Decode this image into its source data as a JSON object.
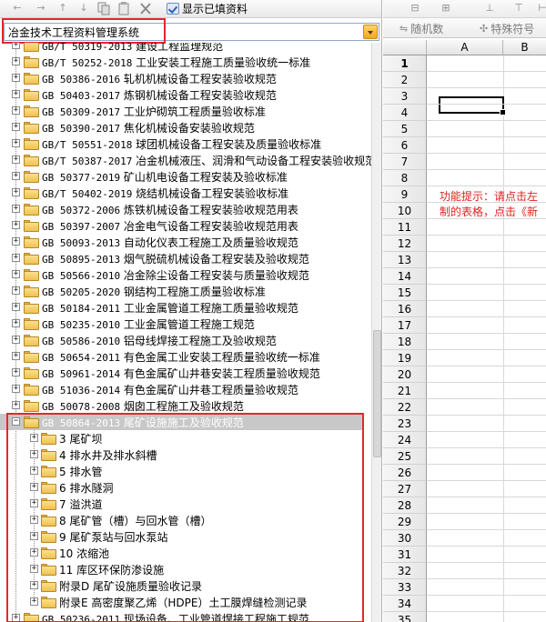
{
  "left_toolbar": {
    "show_filled_label": "显示已填资料",
    "icons": [
      "arrow-left-icon",
      "arrow-right-icon",
      "arrow-up-icon",
      "arrow-down-icon",
      "copy-icon",
      "paste-icon",
      "delete-icon"
    ]
  },
  "system_select": {
    "value": "冶金技术工程资料管理系统"
  },
  "tree": {
    "items": [
      {
        "code": "GB/T 50319-2013",
        "title": "建设工程监理规范"
      },
      {
        "code": "GB/T 50252-2018",
        "title": "工业安装工程施工质量验收统一标准"
      },
      {
        "code": "GB 50386-2016",
        "title": "轧机机械设备工程安装验收规范"
      },
      {
        "code": "GB 50403-2017",
        "title": "炼钢机械设备工程安装验收规范"
      },
      {
        "code": "GB 50309-2017",
        "title": "工业炉砌筑工程质量验收标准"
      },
      {
        "code": "GB 50390-2017",
        "title": "焦化机械设备安装验收规范"
      },
      {
        "code": "GB/T 50551-2018",
        "title": "球团机械设备工程安装及质量验收标准"
      },
      {
        "code": "GB/T 50387-2017",
        "title": "冶金机械液压、润滑和气动设备工程安装验收规范"
      },
      {
        "code": "GB 50377-2019",
        "title": "矿山机电设备工程安装及验收标准"
      },
      {
        "code": "GB/T 50402-2019",
        "title": "烧结机械设备工程安装验收标准"
      },
      {
        "code": "GB 50372-2006",
        "title": "炼铁机械设备工程安装验收规范用表"
      },
      {
        "code": "GB 50397-2007",
        "title": "冶金电气设备工程安装验收规范用表"
      },
      {
        "code": "GB 50093-2013",
        "title": "自动化仪表工程施工及质量验收规范"
      },
      {
        "code": "GB 50895-2013",
        "title": "烟气脱硫机械设备工程安装及验收规范"
      },
      {
        "code": "GB 50566-2010",
        "title": "冶金除尘设备工程安装与质量验收规范"
      },
      {
        "code": "GB 50205-2020",
        "title": "钢结构工程施工质量验收标准"
      },
      {
        "code": "GB 50184-2011",
        "title": "工业金属管道工程施工质量验收规范"
      },
      {
        "code": "GB 50235-2010",
        "title": "工业金属管道工程施工规范"
      },
      {
        "code": "GB 50586-2010",
        "title": "铝母线焊接工程施工及验收规范"
      },
      {
        "code": "GB 50654-2011",
        "title": "有色金属工业安装工程质量验收统一标准"
      },
      {
        "code": "GB 50961-2014",
        "title": "有色金属矿山井巷安装工程质量验收规范"
      },
      {
        "code": "GB 51036-2014",
        "title": "有色金属矿山井巷工程质量验收规范"
      },
      {
        "code": "GB 50078-2008",
        "title": "烟囱工程施工及验收规范"
      }
    ],
    "expanded": {
      "code": "GB 50864-2013",
      "title": "尾矿设施施工及验收规范"
    },
    "children": [
      "3 尾矿坝",
      "4 排水井及排水斜槽",
      "5 排水管",
      "6 排水隧洞",
      "7 溢洪道",
      "8 尾矿管（槽）与回水管（槽）",
      "9 尾矿泵站与回水泵站",
      "10 浓缩池",
      "11 库区环保防渗设施",
      "附录D 尾矿设施质量验收记录",
      "附录E 高密度聚乙烯（HDPE）土工膜焊缝检测记录"
    ],
    "last_partial": {
      "code": "GB 50236-2011",
      "title": "现场设备、工业管道焊接工程施工规范"
    }
  },
  "right_toolbar": {
    "random_label": "随机数",
    "special_label": "特殊符号"
  },
  "sheet": {
    "columns": [
      "A",
      "B"
    ],
    "rows": [
      "1",
      "2",
      "3",
      "4",
      "5",
      "6",
      "7",
      "8",
      "9",
      "10",
      "11",
      "12",
      "13",
      "14",
      "15",
      "16",
      "17",
      "18",
      "19",
      "20",
      "21",
      "22",
      "23",
      "24",
      "25",
      "26",
      "27",
      "28",
      "29",
      "30",
      "31",
      "32",
      "33",
      "34",
      "35"
    ],
    "tip_line1": "功能提示：请点击左",
    "tip_line2": "制的表格，点击《新"
  },
  "colors": {
    "highlight": "#e8262b",
    "tip": "#e02020",
    "folder": "#efc24f"
  }
}
